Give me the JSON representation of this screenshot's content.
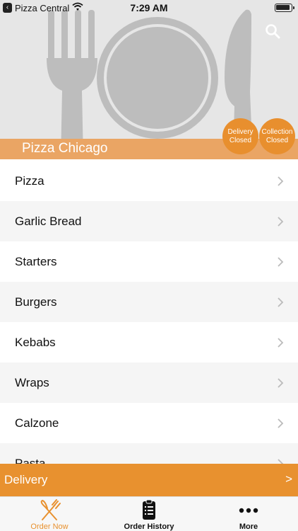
{
  "status_bar": {
    "carrier": "Pizza Central",
    "time": "7:29 AM",
    "back_icon": "back-arrow-icon",
    "wifi_icon": "wifi-icon",
    "battery_icon": "battery-icon"
  },
  "header": {
    "restaurant_name": "Pizza Chicago",
    "search_icon": "search-icon",
    "delivery_status": {
      "line1": "Delivery",
      "line2": "Closed"
    },
    "collection_status": {
      "line1": "Collection",
      "line2": "Closed"
    }
  },
  "menu": {
    "categories": [
      {
        "label": "Pizza"
      },
      {
        "label": "Garlic Bread"
      },
      {
        "label": "Starters"
      },
      {
        "label": "Burgers"
      },
      {
        "label": "Kebabs"
      },
      {
        "label": "Wraps"
      },
      {
        "label": "Calzone"
      },
      {
        "label": "Pasta"
      }
    ]
  },
  "delivery_bar": {
    "label": "Delivery",
    "arrow": ">"
  },
  "tabbar": {
    "tabs": [
      {
        "label": "Order Now",
        "icon": "fork-knife-icon",
        "active": true
      },
      {
        "label": "Order History",
        "icon": "receipt-list-icon",
        "active": false
      },
      {
        "label": "More",
        "icon": "more-dots-icon",
        "active": false
      }
    ]
  },
  "colors": {
    "accent": "#e8912f",
    "restaurant_bar": "#eaa564",
    "hero_bg": "#e6e6e6"
  }
}
